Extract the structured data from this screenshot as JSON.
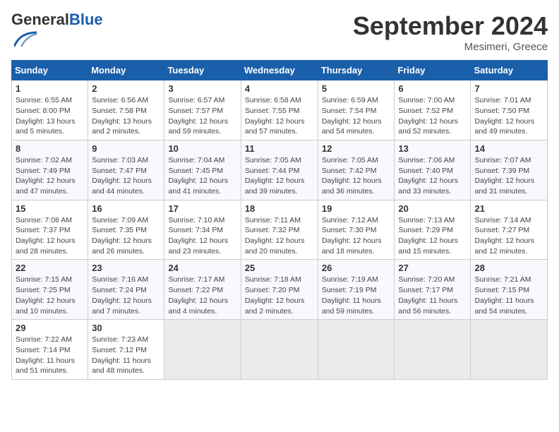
{
  "header": {
    "logo_general": "General",
    "logo_blue": "Blue",
    "month_title": "September 2024",
    "location": "Mesimeri, Greece"
  },
  "days_of_week": [
    "Sunday",
    "Monday",
    "Tuesday",
    "Wednesday",
    "Thursday",
    "Friday",
    "Saturday"
  ],
  "weeks": [
    [
      {
        "num": "1",
        "sunrise": "Sunrise: 6:55 AM",
        "sunset": "Sunset: 8:00 PM",
        "daylight": "Daylight: 13 hours and 5 minutes."
      },
      {
        "num": "2",
        "sunrise": "Sunrise: 6:56 AM",
        "sunset": "Sunset: 7:58 PM",
        "daylight": "Daylight: 13 hours and 2 minutes."
      },
      {
        "num": "3",
        "sunrise": "Sunrise: 6:57 AM",
        "sunset": "Sunset: 7:57 PM",
        "daylight": "Daylight: 12 hours and 59 minutes."
      },
      {
        "num": "4",
        "sunrise": "Sunrise: 6:58 AM",
        "sunset": "Sunset: 7:55 PM",
        "daylight": "Daylight: 12 hours and 57 minutes."
      },
      {
        "num": "5",
        "sunrise": "Sunrise: 6:59 AM",
        "sunset": "Sunset: 7:54 PM",
        "daylight": "Daylight: 12 hours and 54 minutes."
      },
      {
        "num": "6",
        "sunrise": "Sunrise: 7:00 AM",
        "sunset": "Sunset: 7:52 PM",
        "daylight": "Daylight: 12 hours and 52 minutes."
      },
      {
        "num": "7",
        "sunrise": "Sunrise: 7:01 AM",
        "sunset": "Sunset: 7:50 PM",
        "daylight": "Daylight: 12 hours and 49 minutes."
      }
    ],
    [
      {
        "num": "8",
        "sunrise": "Sunrise: 7:02 AM",
        "sunset": "Sunset: 7:49 PM",
        "daylight": "Daylight: 12 hours and 47 minutes."
      },
      {
        "num": "9",
        "sunrise": "Sunrise: 7:03 AM",
        "sunset": "Sunset: 7:47 PM",
        "daylight": "Daylight: 12 hours and 44 minutes."
      },
      {
        "num": "10",
        "sunrise": "Sunrise: 7:04 AM",
        "sunset": "Sunset: 7:45 PM",
        "daylight": "Daylight: 12 hours and 41 minutes."
      },
      {
        "num": "11",
        "sunrise": "Sunrise: 7:05 AM",
        "sunset": "Sunset: 7:44 PM",
        "daylight": "Daylight: 12 hours and 39 minutes."
      },
      {
        "num": "12",
        "sunrise": "Sunrise: 7:05 AM",
        "sunset": "Sunset: 7:42 PM",
        "daylight": "Daylight: 12 hours and 36 minutes."
      },
      {
        "num": "13",
        "sunrise": "Sunrise: 7:06 AM",
        "sunset": "Sunset: 7:40 PM",
        "daylight": "Daylight: 12 hours and 33 minutes."
      },
      {
        "num": "14",
        "sunrise": "Sunrise: 7:07 AM",
        "sunset": "Sunset: 7:39 PM",
        "daylight": "Daylight: 12 hours and 31 minutes."
      }
    ],
    [
      {
        "num": "15",
        "sunrise": "Sunrise: 7:08 AM",
        "sunset": "Sunset: 7:37 PM",
        "daylight": "Daylight: 12 hours and 28 minutes."
      },
      {
        "num": "16",
        "sunrise": "Sunrise: 7:09 AM",
        "sunset": "Sunset: 7:35 PM",
        "daylight": "Daylight: 12 hours and 26 minutes."
      },
      {
        "num": "17",
        "sunrise": "Sunrise: 7:10 AM",
        "sunset": "Sunset: 7:34 PM",
        "daylight": "Daylight: 12 hours and 23 minutes."
      },
      {
        "num": "18",
        "sunrise": "Sunrise: 7:11 AM",
        "sunset": "Sunset: 7:32 PM",
        "daylight": "Daylight: 12 hours and 20 minutes."
      },
      {
        "num": "19",
        "sunrise": "Sunrise: 7:12 AM",
        "sunset": "Sunset: 7:30 PM",
        "daylight": "Daylight: 12 hours and 18 minutes."
      },
      {
        "num": "20",
        "sunrise": "Sunrise: 7:13 AM",
        "sunset": "Sunset: 7:29 PM",
        "daylight": "Daylight: 12 hours and 15 minutes."
      },
      {
        "num": "21",
        "sunrise": "Sunrise: 7:14 AM",
        "sunset": "Sunset: 7:27 PM",
        "daylight": "Daylight: 12 hours and 12 minutes."
      }
    ],
    [
      {
        "num": "22",
        "sunrise": "Sunrise: 7:15 AM",
        "sunset": "Sunset: 7:25 PM",
        "daylight": "Daylight: 12 hours and 10 minutes."
      },
      {
        "num": "23",
        "sunrise": "Sunrise: 7:16 AM",
        "sunset": "Sunset: 7:24 PM",
        "daylight": "Daylight: 12 hours and 7 minutes."
      },
      {
        "num": "24",
        "sunrise": "Sunrise: 7:17 AM",
        "sunset": "Sunset: 7:22 PM",
        "daylight": "Daylight: 12 hours and 4 minutes."
      },
      {
        "num": "25",
        "sunrise": "Sunrise: 7:18 AM",
        "sunset": "Sunset: 7:20 PM",
        "daylight": "Daylight: 12 hours and 2 minutes."
      },
      {
        "num": "26",
        "sunrise": "Sunrise: 7:19 AM",
        "sunset": "Sunset: 7:19 PM",
        "daylight": "Daylight: 11 hours and 59 minutes."
      },
      {
        "num": "27",
        "sunrise": "Sunrise: 7:20 AM",
        "sunset": "Sunset: 7:17 PM",
        "daylight": "Daylight: 11 hours and 56 minutes."
      },
      {
        "num": "28",
        "sunrise": "Sunrise: 7:21 AM",
        "sunset": "Sunset: 7:15 PM",
        "daylight": "Daylight: 11 hours and 54 minutes."
      }
    ],
    [
      {
        "num": "29",
        "sunrise": "Sunrise: 7:22 AM",
        "sunset": "Sunset: 7:14 PM",
        "daylight": "Daylight: 11 hours and 51 minutes."
      },
      {
        "num": "30",
        "sunrise": "Sunrise: 7:23 AM",
        "sunset": "Sunset: 7:12 PM",
        "daylight": "Daylight: 11 hours and 48 minutes."
      },
      null,
      null,
      null,
      null,
      null
    ]
  ]
}
